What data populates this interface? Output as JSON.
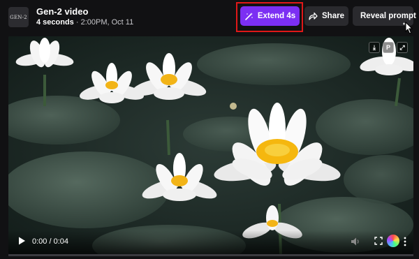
{
  "header": {
    "logo_text": "GEN-2",
    "title": "Gen-2 video",
    "duration": "4 seconds",
    "separator": "·",
    "timestamp": "2:00PM, Oct 11"
  },
  "actions": {
    "extend_label": "Extend 4s",
    "share_label": "Share",
    "reveal_label": "Reveal prompt"
  },
  "video": {
    "tool_download": "⤓",
    "tool_p": "P",
    "tool_expand": "⤢",
    "time_display": "0:00 / 0:04",
    "progress": 0.0
  },
  "colors": {
    "accent": "#7c2ff3",
    "highlight": "#e01818"
  }
}
